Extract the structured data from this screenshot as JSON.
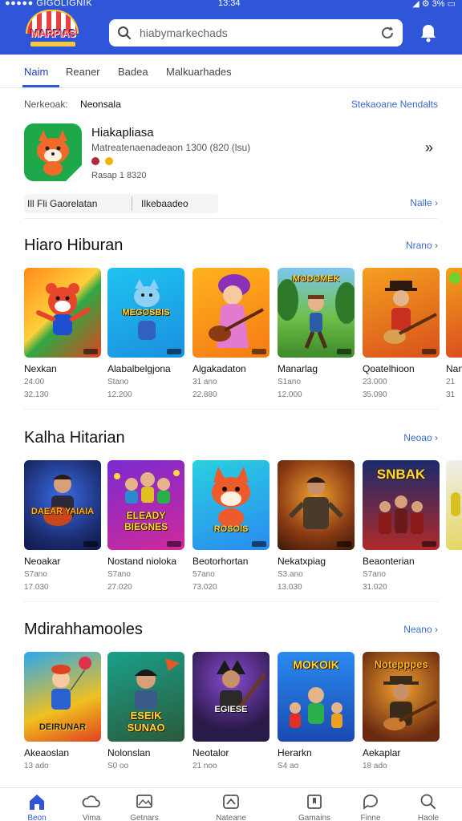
{
  "status_bar": {
    "left": "●●●●● GIGOLIGNIK",
    "time": "13:34",
    "right": "◢ ⚙ 3% ▭"
  },
  "header": {
    "logo_text": "MARPIAS",
    "search": {
      "placeholder": "hiabymarkechads"
    }
  },
  "tabs": [
    {
      "label": "Naim",
      "active": true
    },
    {
      "label": "Reaner",
      "active": false
    },
    {
      "label": "Badea",
      "active": false
    },
    {
      "label": "Malkuarhades",
      "active": false
    }
  ],
  "featured": {
    "key": "Nerkeoak:",
    "value": "Neonsala",
    "link": "Stekaoane Nendalts",
    "title": "Hiakapliasa",
    "subtitle": "Matreatenaenadeaon 1300 (820 (lsu)",
    "info": "Rasap  1  8320",
    "strip_a": "Ill  Fli  Gaorelatan",
    "strip_b": "Ilkebaadeo",
    "more": "Nalle"
  },
  "sections": [
    {
      "title": "Hiaro Hiburan",
      "link": "Nrano",
      "items": [
        {
          "name": "Nexkan",
          "line1": "24.00",
          "line2": "32.130",
          "art": ""
        },
        {
          "name": "Alabalbelgjona",
          "line1": "Stano",
          "line2": "12.200",
          "art": "MEGOSBIS"
        },
        {
          "name": "Algakadaton",
          "line1": "31 ano",
          "line2": "22.880",
          "art": ""
        },
        {
          "name": "Manarlag",
          "line1": "S1ano",
          "line2": "12.000",
          "art": "MODOMEK"
        },
        {
          "name": "Qoatelhioon",
          "line1": "23.000",
          "line2": "35.090",
          "art": ""
        },
        {
          "name": "Nan",
          "line1": "21",
          "line2": "31",
          "art": ""
        }
      ]
    },
    {
      "title": "Kalha Hitarian",
      "link": "Neoao",
      "items": [
        {
          "name": "Neoakar",
          "line1": "S7ano",
          "line2": "17.030",
          "art": "DAEAR YAIAIA"
        },
        {
          "name": "Nostand nioloka",
          "line1": "S7ano",
          "line2": "27.020",
          "art": "ELEADY BIEGNES"
        },
        {
          "name": "Beotorhortan",
          "line1": "57ano",
          "line2": "73.020",
          "art": "ROSOIS"
        },
        {
          "name": "Nekatxpiag",
          "line1": "S3.ano",
          "line2": "13.030",
          "art": ""
        },
        {
          "name": "Beaonterian",
          "line1": "S7ano",
          "line2": "31.020",
          "art": "SNBAK"
        },
        {
          "name": "",
          "line1": "",
          "line2": "",
          "art": ""
        }
      ]
    },
    {
      "title": "Mdirahhamooles",
      "link": "Neano",
      "items": [
        {
          "name": "Akeaoslan",
          "line1": "13 ado",
          "line2": "",
          "art": "DEIRUNAR"
        },
        {
          "name": "Nolonslan",
          "line1": "S0 oo",
          "line2": "",
          "art": "ESEIK SUNAO"
        },
        {
          "name": "Neotalor",
          "line1": "21 noo",
          "line2": "",
          "art": "EGIESE"
        },
        {
          "name": "Herarkn",
          "line1": "S4 ao",
          "line2": "",
          "art": "MOKOIK"
        },
        {
          "name": "Aekaplar",
          "line1": "18 ado",
          "line2": "",
          "art": "Notepppes"
        }
      ]
    }
  ],
  "bottom_nav": [
    {
      "label": "Beon",
      "icon": "home-icon",
      "active": true
    },
    {
      "label": "Vima",
      "icon": "cloud-icon",
      "active": false
    },
    {
      "label": "Getnars",
      "icon": "image-icon",
      "active": false
    },
    {
      "label": "Nateane",
      "icon": "share-icon",
      "active": false
    },
    {
      "label": "Gamains",
      "icon": "bookmark-icon",
      "active": false
    },
    {
      "label": "Finne",
      "icon": "chat-icon",
      "active": false
    },
    {
      "label": "Haole",
      "icon": "search-icon",
      "active": false
    }
  ],
  "colors": {
    "header": "#2f56d8",
    "accent": "#3a6bd0"
  }
}
